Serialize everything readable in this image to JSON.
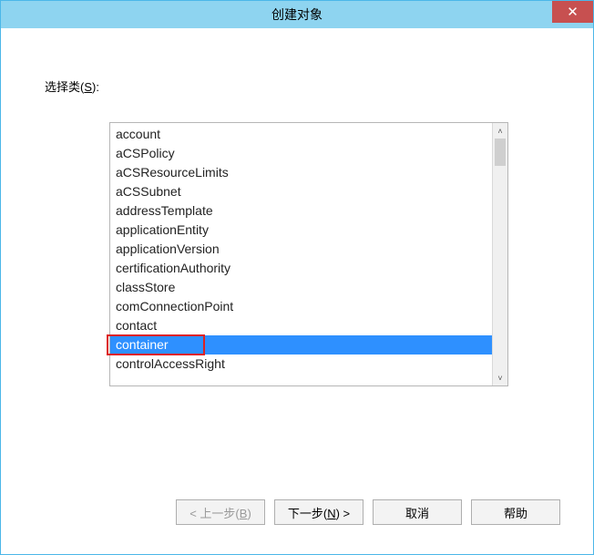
{
  "window": {
    "title": "创建对象"
  },
  "label": {
    "prefix": "选择类(",
    "mnemonic": "S",
    "suffix": "):"
  },
  "list": {
    "items": [
      {
        "label": "account",
        "selected": false
      },
      {
        "label": "aCSPolicy",
        "selected": false
      },
      {
        "label": "aCSResourceLimits",
        "selected": false
      },
      {
        "label": "aCSSubnet",
        "selected": false
      },
      {
        "label": "addressTemplate",
        "selected": false
      },
      {
        "label": "applicationEntity",
        "selected": false
      },
      {
        "label": "applicationVersion",
        "selected": false
      },
      {
        "label": "certificationAuthority",
        "selected": false
      },
      {
        "label": "classStore",
        "selected": false
      },
      {
        "label": "comConnectionPoint",
        "selected": false
      },
      {
        "label": "contact",
        "selected": false
      },
      {
        "label": "container",
        "selected": true
      },
      {
        "label": "controlAccessRight",
        "selected": false
      }
    ]
  },
  "buttons": {
    "back": {
      "pre": "< 上一步(",
      "m": "B",
      "post": ")",
      "enabled": false
    },
    "next": {
      "pre": "下一步(",
      "m": "N",
      "post": ") >",
      "enabled": true
    },
    "cancel": {
      "label": "取消",
      "enabled": true
    },
    "help": {
      "label": "帮助",
      "enabled": true
    }
  }
}
